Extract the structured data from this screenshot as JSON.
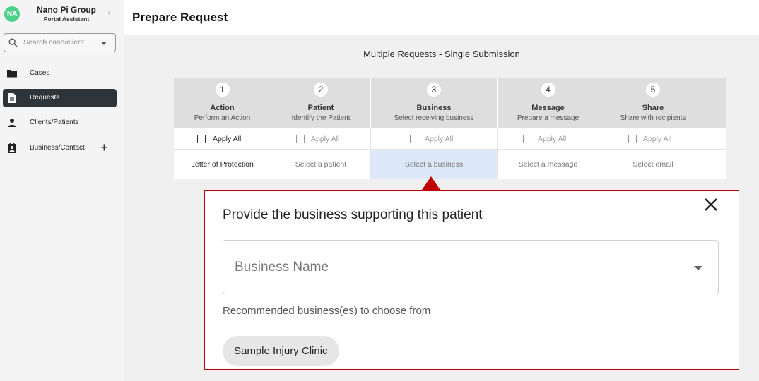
{
  "sidebar": {
    "avatar_initials": "NA",
    "brand_name": "Nano Pi Group",
    "brand_sub": "Portal Assistant",
    "collapse_icon": "‹",
    "search_placeholder": "Search case/client",
    "items": [
      {
        "label": "Cases",
        "icon": "folder-icon",
        "active": false
      },
      {
        "label": "Requests",
        "icon": "document-icon",
        "active": true
      },
      {
        "label": "Clients/Patients",
        "icon": "person-icon",
        "active": false
      },
      {
        "label": "Business/Contact",
        "icon": "contact-book-icon",
        "active": false
      }
    ],
    "add_icon": "+"
  },
  "header": {
    "title": "Prepare Request"
  },
  "main": {
    "subtitle": "Multiple Requests - Single Submission",
    "steps": [
      {
        "num": "1",
        "title": "Action",
        "sub": "Perform an Action",
        "apply": "Apply All",
        "select": "Letter of Protection"
      },
      {
        "num": "2",
        "title": "Patient",
        "sub": "Identify the Patient",
        "apply": "Apply All",
        "select": "Select a patient"
      },
      {
        "num": "3",
        "title": "Business",
        "sub": "Select receiving business",
        "apply": "Apply All",
        "select": "Select a business"
      },
      {
        "num": "4",
        "title": "Message",
        "sub": "Prepare a message",
        "apply": "Apply All",
        "select": "Select a message"
      },
      {
        "num": "5",
        "title": "Share",
        "sub": "Share with recipients",
        "apply": "Apply All",
        "select": "Select email"
      }
    ],
    "active_step_index": 2
  },
  "popover": {
    "title": "Provide the business supporting this patient",
    "select_placeholder": "Business Name",
    "recommended_label": "Recommended business(es) to choose from",
    "recommended": [
      "Sample Injury Clinic"
    ],
    "close_icon": "close-icon"
  },
  "colors": {
    "accent_red": "#c00000",
    "active_nav": "#2f3438",
    "avatar": "#4cd08a",
    "active_cell": "#dde9f8"
  }
}
